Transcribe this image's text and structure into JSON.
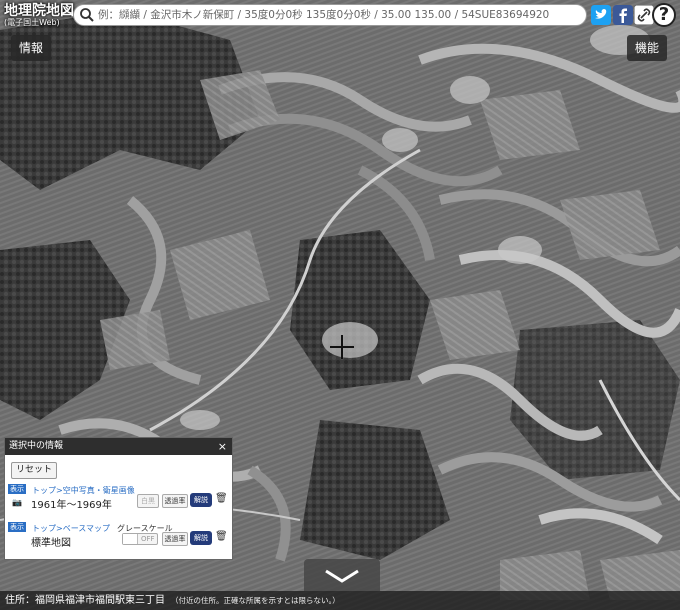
{
  "app": {
    "title_line1": "地理院地図",
    "title_line2": "(電子国土Web)"
  },
  "search": {
    "placeholder": "例：纐纈 / 金沢市木ノ新保町 / 35度0分0秒 135度0分0秒 / 35.00 135.00 / 54SUE83694920"
  },
  "icons": {
    "search": "search-icon",
    "twitter": "twitter-icon",
    "facebook": "facebook-icon",
    "link": "link-icon",
    "help": "help-icon",
    "crosshair": "crosshair-icon",
    "camera": "camera-icon",
    "trash": "trash-icon",
    "chevron": "chevron-down-icon"
  },
  "buttons": {
    "info": "情報",
    "functions": "機能",
    "help": "?"
  },
  "panel": {
    "title": "選択中の情報",
    "close": "×",
    "reset": "リセット",
    "layers": [
      {
        "tag": "表示",
        "path": "トップ>空中写真・衛星画像",
        "name": "1961年〜1969年",
        "btn_gray": "白黒",
        "btn_opacity": "透過率",
        "btn_info": "解説"
      },
      {
        "tag": "表示",
        "path": "トップ>ベースマップ",
        "name": "標準地図",
        "grayscale_label": "グレースケール",
        "grayscale_state": "OFF",
        "btn_opacity": "透過率",
        "btn_info": "解説"
      }
    ]
  },
  "footer": {
    "label": "住所：",
    "address": "福岡県福津市福間駅東三丁目",
    "note": "（付近の住所。正確な所属を示すとは限らない。）"
  },
  "colors": {
    "twitter": "#1da1f2",
    "facebook": "#3b5998",
    "kaisetsu": "#243b7a",
    "tag": "#2a6ec4"
  }
}
